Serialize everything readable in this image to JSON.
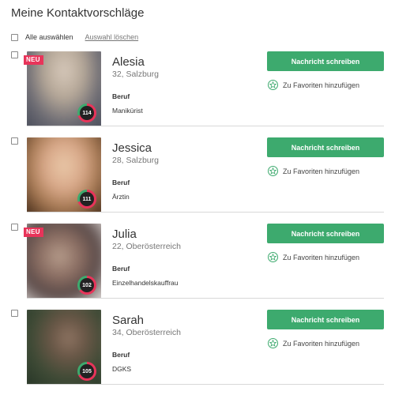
{
  "page": {
    "title": "Meine Kontaktvorschläge",
    "select_all_label": "Alle auswählen",
    "clear_selection_label": "Auswahl löschen"
  },
  "labels": {
    "job": "Beruf",
    "send_message": "Nachricht schreiben",
    "add_favorite": "Zu Favoriten hinzufügen",
    "new_badge": "NEU"
  },
  "colors": {
    "accent_green": "#3daa6e",
    "badge_pink": "#e8345a",
    "score_ring": "#e8345a"
  },
  "contacts": [
    {
      "name": "Alesia",
      "meta": "32, Salzburg",
      "job": "Manikürist",
      "score": "114",
      "is_new": true
    },
    {
      "name": "Jessica",
      "meta": "28, Salzburg",
      "job": "Ärztin",
      "score": "111",
      "is_new": false
    },
    {
      "name": "Julia",
      "meta": "22, Oberösterreich",
      "job": "Einzelhandelskauffrau",
      "score": "102",
      "is_new": true
    },
    {
      "name": "Sarah",
      "meta": "34, Oberösterreich",
      "job": "DGKS",
      "score": "105",
      "is_new": false
    }
  ]
}
